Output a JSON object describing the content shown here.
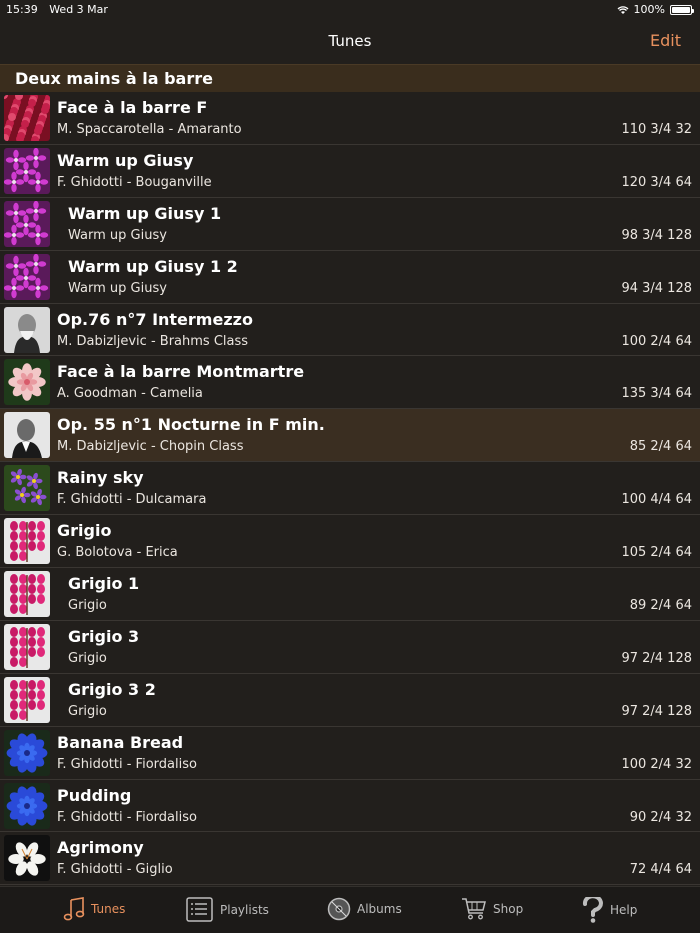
{
  "status": {
    "time": "15:39",
    "date": "Wed 3 Mar",
    "battery": "100%",
    "battery_level": 1.0
  },
  "nav": {
    "title": "Tunes",
    "edit_label": "Edit"
  },
  "section": {
    "title": "Deux mains à la barre"
  },
  "colors": {
    "accent": "#e8915e",
    "background": "#221f1c",
    "section_bg": "#3a2d1d",
    "selected_bg": "#3a2e21"
  },
  "tunes": [
    {
      "title": "Face à la barre F",
      "subtitle": "M. Spaccarotella - Amaranto",
      "meta": "110 3/4 32",
      "thumb": "amaranth-flower-thumbnail",
      "indent": false,
      "selected": false
    },
    {
      "title": "Warm up Giusy",
      "subtitle": "F. Ghidotti - Bouganville",
      "meta": "120 3/4 64",
      "thumb": "bougainvillea-flower-thumbnail",
      "indent": false,
      "selected": false
    },
    {
      "title": "Warm up Giusy 1",
      "subtitle": "Warm up Giusy",
      "meta": "98 3/4 128",
      "thumb": "bougainvillea-flower-thumbnail",
      "indent": true,
      "selected": false
    },
    {
      "title": "Warm up Giusy 1 2",
      "subtitle": "Warm up Giusy",
      "meta": "94 3/4 128",
      "thumb": "bougainvillea-flower-thumbnail",
      "indent": true,
      "selected": false
    },
    {
      "title": "Op.76 n°7 Intermezzo",
      "subtitle": "M. Dabizljevic - Brahms Class",
      "meta": "100 2/4 64",
      "thumb": "brahms-portrait-thumbnail",
      "indent": false,
      "selected": false
    },
    {
      "title": "Face à la barre Montmartre",
      "subtitle": "A. Goodman - Camelia",
      "meta": "135 3/4 64",
      "thumb": "camellia-flower-thumbnail",
      "indent": false,
      "selected": false
    },
    {
      "title": "Op. 55 n°1 Nocturne in F min.",
      "subtitle": "M. Dabizljevic - Chopin Class",
      "meta": "85 2/4 64",
      "thumb": "chopin-portrait-thumbnail",
      "indent": false,
      "selected": true
    },
    {
      "title": "Rainy sky",
      "subtitle": "F. Ghidotti - Dulcamara",
      "meta": "100 4/4 64",
      "thumb": "bittersweet-flower-thumbnail",
      "indent": false,
      "selected": false
    },
    {
      "title": "Grigio",
      "subtitle": "G. Bolotova - Erica",
      "meta": "105 2/4 64",
      "thumb": "heather-flower-thumbnail",
      "indent": false,
      "selected": false
    },
    {
      "title": "Grigio 1",
      "subtitle": "Grigio",
      "meta": "89 2/4 64",
      "thumb": "heather-flower-thumbnail",
      "indent": true,
      "selected": false
    },
    {
      "title": "Grigio 3",
      "subtitle": "Grigio",
      "meta": "97 2/4 128",
      "thumb": "heather-flower-thumbnail",
      "indent": true,
      "selected": false
    },
    {
      "title": "Grigio 3 2",
      "subtitle": "Grigio",
      "meta": "97 2/4 128",
      "thumb": "heather-flower-thumbnail",
      "indent": true,
      "selected": false
    },
    {
      "title": "Banana Bread",
      "subtitle": "F. Ghidotti - Fiordaliso",
      "meta": "100 2/4 32",
      "thumb": "cornflower-thumbnail",
      "indent": false,
      "selected": false
    },
    {
      "title": "Pudding",
      "subtitle": "F. Ghidotti - Fiordaliso",
      "meta": "90 2/4 32",
      "thumb": "cornflower-thumbnail",
      "indent": false,
      "selected": false
    },
    {
      "title": "Agrimony",
      "subtitle": "F. Ghidotti - Giglio",
      "meta": "72 4/4 64",
      "thumb": "lily-flower-thumbnail",
      "indent": false,
      "selected": false
    }
  ],
  "tabs": [
    {
      "label": "Tunes",
      "icon": "music-note-icon",
      "active": true
    },
    {
      "label": "Playlists",
      "icon": "playlist-icon",
      "active": false
    },
    {
      "label": "Albums",
      "icon": "album-disc-icon",
      "active": false
    },
    {
      "label": "Shop",
      "icon": "shopping-cart-icon",
      "active": false
    },
    {
      "label": "Help",
      "icon": "question-mark-icon",
      "active": false
    }
  ]
}
